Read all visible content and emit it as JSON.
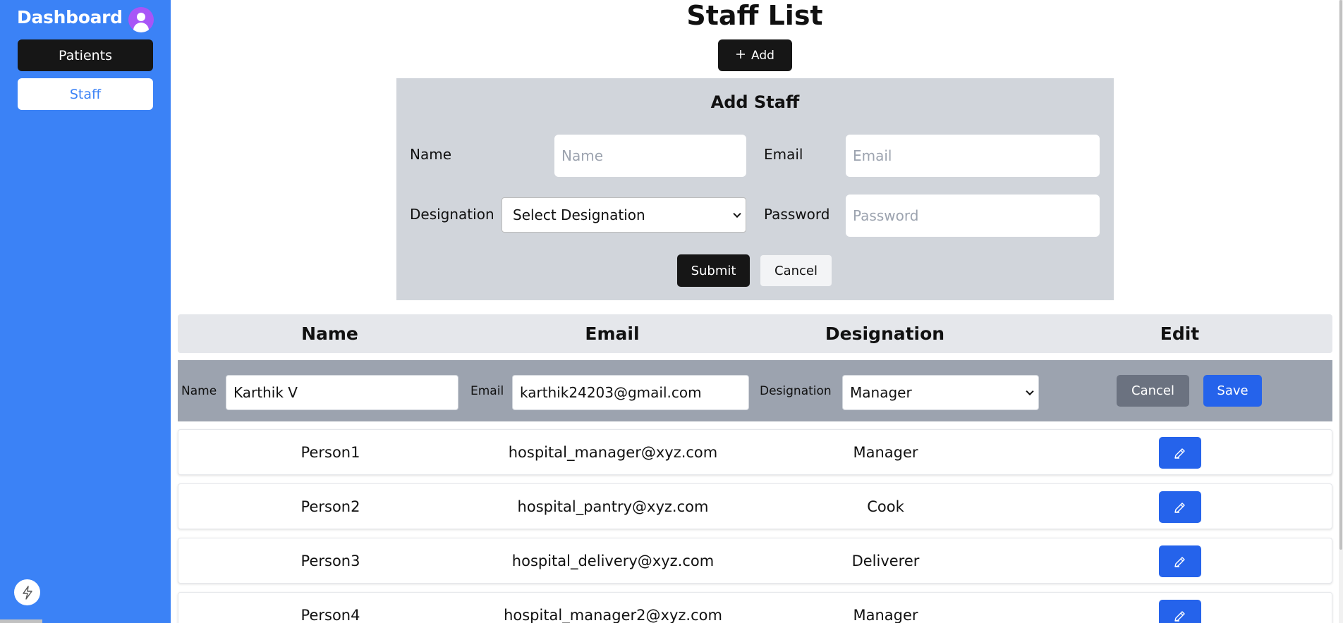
{
  "sidebar": {
    "title": "Dashboard",
    "avatar_icon": "user-avatar-icon",
    "items": [
      {
        "label": "Patients",
        "active": false
      },
      {
        "label": "Staff",
        "active": true
      }
    ],
    "bottom_icon": "lightning-icon"
  },
  "page": {
    "title": "Staff List",
    "add_label": "Add"
  },
  "form": {
    "title": "Add Staff",
    "name_label": "Name",
    "name_placeholder": "Name",
    "email_label": "Email",
    "email_placeholder": "Email",
    "designation_label": "Designation",
    "designation_value": "Select Designation",
    "password_label": "Password",
    "password_placeholder": "Password",
    "submit_label": "Submit",
    "cancel_label": "Cancel"
  },
  "table": {
    "headers": [
      "Name",
      "Email",
      "Designation",
      "Edit"
    ],
    "edit_row": {
      "name_label": "Name",
      "name_value": "Karthik V",
      "email_label": "Email",
      "email_value": "karthik24203@gmail.com",
      "designation_label": "Designation",
      "designation_value": "Manager",
      "cancel_label": "Cancel",
      "save_label": "Save"
    },
    "rows": [
      {
        "name": "Person1",
        "email": "hospital_manager@xyz.com",
        "designation": "Manager"
      },
      {
        "name": "Person2",
        "email": "hospital_pantry@xyz.com",
        "designation": "Cook"
      },
      {
        "name": "Person3",
        "email": "hospital_delivery@xyz.com",
        "designation": "Deliverer"
      },
      {
        "name": "Person4",
        "email": "hospital_manager2@xyz.com",
        "designation": "Manager"
      }
    ]
  },
  "colors": {
    "sidebar": "#3b82f6",
    "dark_button": "#161616",
    "primary": "#2563eb",
    "form_panel": "#d1d5db",
    "edit_row": "#9ca3af"
  }
}
